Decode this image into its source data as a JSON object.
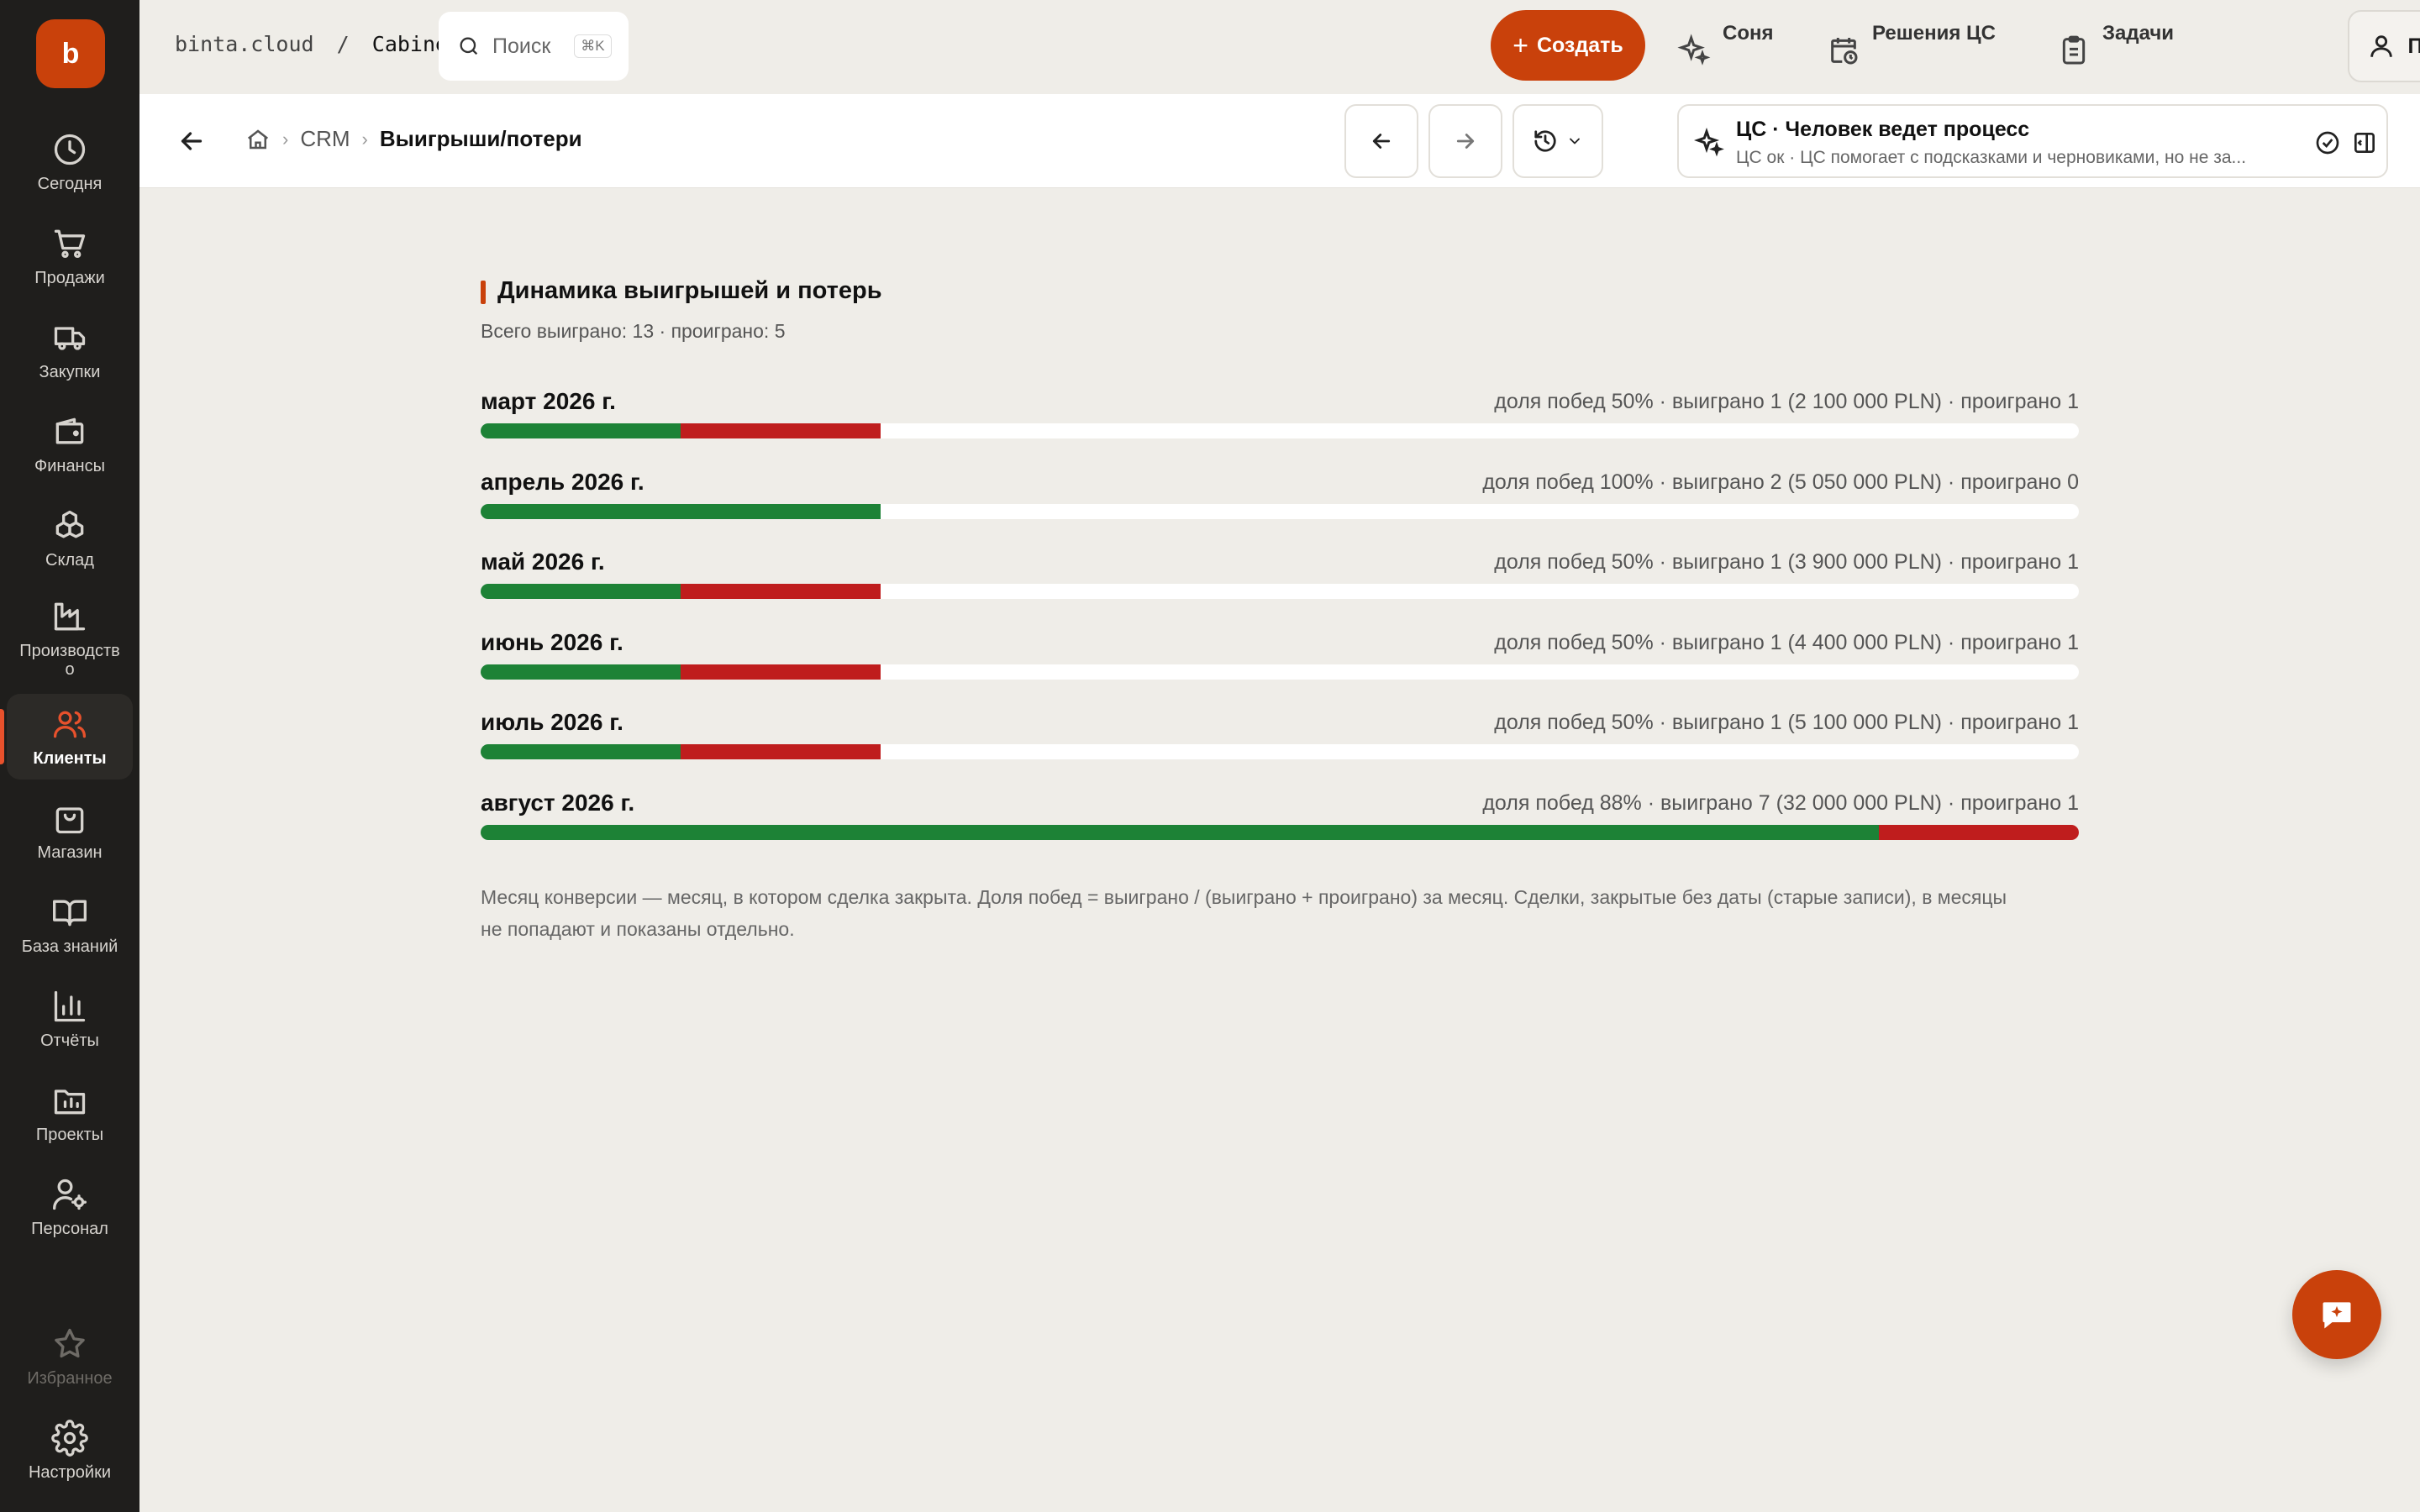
{
  "app": {
    "logo_letter": "b",
    "site": "binta.cloud",
    "crumb_sep": "/",
    "workspace": "Cabinet",
    "accent_color": "#C9410B"
  },
  "sidebar": {
    "items": [
      {
        "label": "Сегодня",
        "icon": "clock-icon"
      },
      {
        "label": "Продажи",
        "icon": "cart-icon"
      },
      {
        "label": "Закупки",
        "icon": "truck-icon"
      },
      {
        "label": "Финансы",
        "icon": "wallet-icon"
      },
      {
        "label": "Склад",
        "icon": "boxes-icon"
      },
      {
        "label": "Производство",
        "icon": "factory-icon"
      },
      {
        "label": "Клиенты",
        "icon": "users-icon",
        "active": true
      },
      {
        "label": "Магазин",
        "icon": "shopping-bag-icon"
      },
      {
        "label": "База знаний",
        "icon": "book-icon"
      },
      {
        "label": "Отчёты",
        "icon": "bar-chart-icon"
      },
      {
        "label": "Проекты",
        "icon": "folder-chart-icon"
      },
      {
        "label": "Персонал",
        "icon": "user-gear-icon"
      }
    ],
    "favorites": "Избранное",
    "settings": "Настройки"
  },
  "topbar": {
    "search_label": "Поиск",
    "search_shortcut": "⌘K",
    "create_label": "Создать",
    "tools": [
      "Соня",
      "Решения ЦС",
      "Задачи"
    ],
    "profile_label": "Профиль"
  },
  "breadcrumb": {
    "section": "CRM",
    "current": "Выигрыши/потери"
  },
  "ai_panel": {
    "title": "ЦС · Человек ведет процесс",
    "subtitle": "ЦС ок · ЦС помогает с подсказками и черновиками, но не за..."
  },
  "section": {
    "title": "Динамика выигрышей и потерь",
    "subtitle": "Всего выиграно: 13 · проиграно: 5",
    "note": "Месяц конверсии — месяц, в котором сделка закрыта. Доля побед = выиграно / (выиграно + проиграно) за месяц. Сделки, закрытые без даты (старые записи), в месяцы не попадают и показаны отдельно."
  },
  "chart_data": {
    "type": "bar",
    "categories": [
      "март 2026 г.",
      "апрель 2026 г.",
      "май 2026 г.",
      "июнь 2026 г.",
      "июль 2026 г.",
      "август 2026 г."
    ],
    "series": [
      {
        "values": [
          1,
          2,
          1,
          1,
          1,
          7
        ]
      },
      {
        "values": [
          1,
          0,
          1,
          1,
          1,
          1
        ]
      }
    ],
    "colors": {
      "won": "#1D8236",
      "lost": "#BF1D1D"
    },
    "stats": [
      "доля побед 50% · выиграно 1 (2 100 000 PLN) · проиграно 1",
      "доля побед 100% · выиграно 2 (5 050 000 PLN) · проиграно 0",
      "доля побед 50% · выиграно 1 (3 900 000 PLN) · проиграно 1",
      "доля побед 50% · выиграно 1 (4 400 000 PLN) · проиграно 1",
      "доля побед 50% · выиграно 1 (5 100 000 PLN) · проиграно 1",
      "доля побед 88% · выиграно 7 (32 000 000 PLN) · проиграно 1"
    ],
    "xlim": [
      0,
      8
    ]
  }
}
